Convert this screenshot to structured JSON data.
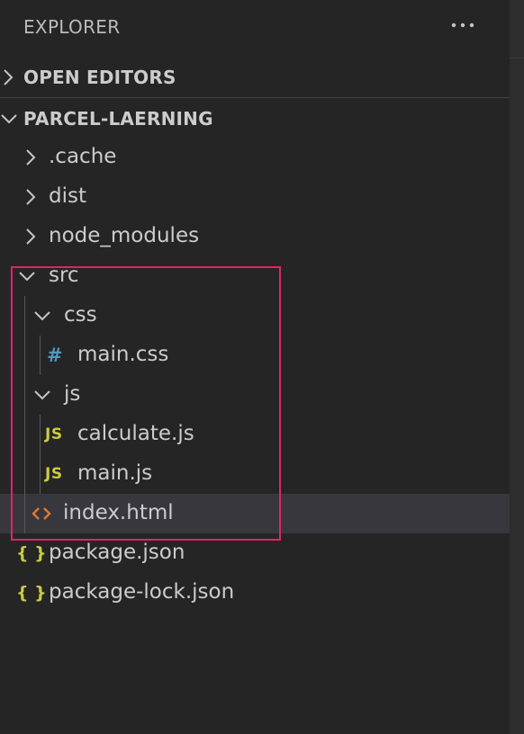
{
  "header": {
    "title": "EXPLORER",
    "more_icon": "ellipsis-icon"
  },
  "sections": {
    "open_editors": {
      "label": "OPEN EDITORS",
      "expanded": false
    },
    "project": {
      "label": "PARCEL-LAERNING",
      "expanded": true
    }
  },
  "tree": {
    "cache": {
      "name": ".cache",
      "type": "folder",
      "expanded": false
    },
    "dist": {
      "name": "dist",
      "type": "folder",
      "expanded": false
    },
    "node_modules": {
      "name": "node_modules",
      "type": "folder",
      "expanded": false
    },
    "src": {
      "name": "src",
      "type": "folder",
      "expanded": true
    },
    "css": {
      "name": "css",
      "type": "folder",
      "expanded": true
    },
    "main_css": {
      "name": "main.css",
      "type": "file",
      "icon": "hash-icon",
      "icon_text": "#"
    },
    "js": {
      "name": "js",
      "type": "folder",
      "expanded": true
    },
    "calculate_js": {
      "name": "calculate.js",
      "type": "file",
      "icon": "js-file-icon",
      "icon_text": "JS"
    },
    "main_js": {
      "name": "main.js",
      "type": "file",
      "icon": "js-file-icon",
      "icon_text": "JS"
    },
    "index_html": {
      "name": "index.html",
      "type": "file",
      "icon": "html-file-icon",
      "selected": true
    },
    "package_json": {
      "name": "package.json",
      "type": "file",
      "icon": "json-file-icon",
      "icon_text": "{ }"
    },
    "package_lock_json": {
      "name": "package-lock.json",
      "type": "file",
      "icon": "json-file-icon",
      "icon_text": "{ }"
    }
  },
  "colors": {
    "background": "#252526",
    "selected_row": "#37373d",
    "highlight_border": "#e0246b",
    "css_icon": "#519aba",
    "js_icon": "#cbcb41",
    "html_icon": "#e37933",
    "json_icon": "#cbcb41"
  }
}
